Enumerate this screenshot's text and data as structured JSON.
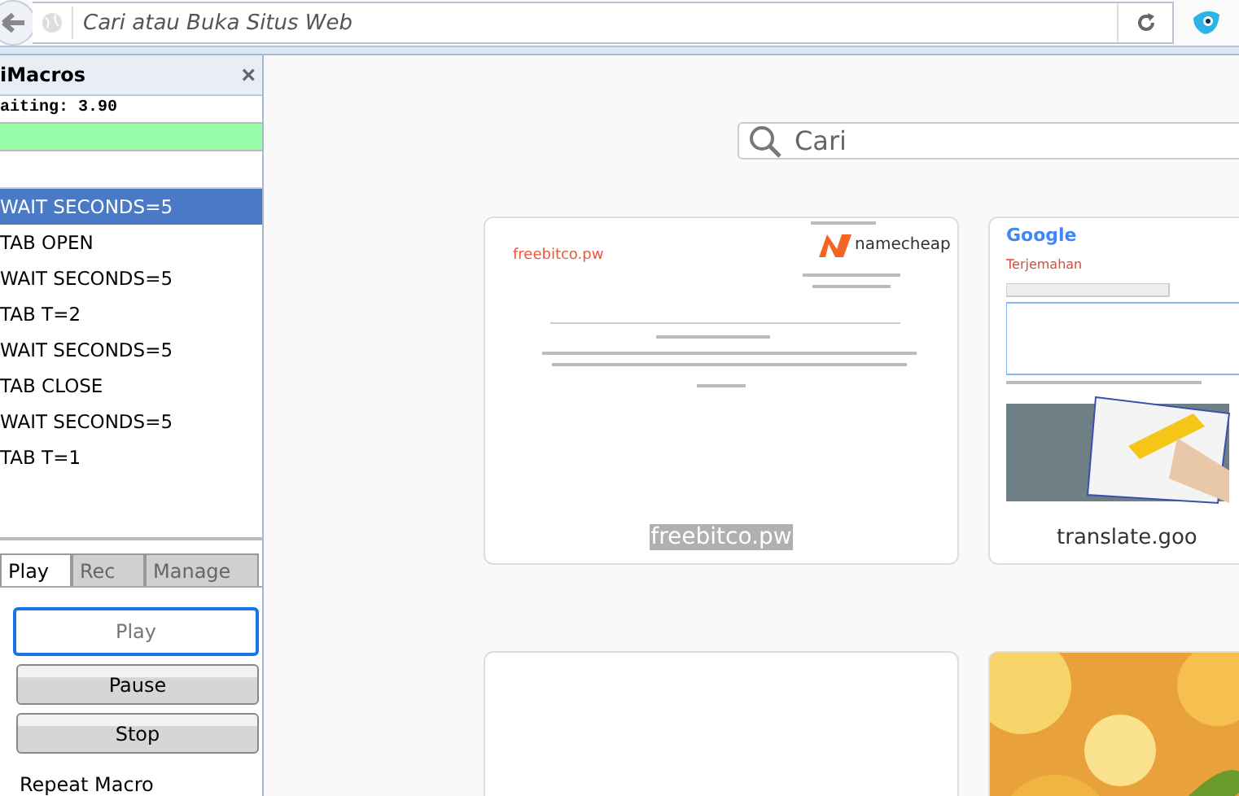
{
  "toolbar": {
    "url_placeholder": "Cari atau Buka Situs Web"
  },
  "sidebar": {
    "title": "iMacros",
    "close": "×",
    "status": "aiting: 3.90",
    "progress": {
      "level": 1
    },
    "macro_lines": [
      {
        "text": "WAIT SECONDS=5",
        "selected": true
      },
      {
        "text": "TAB OPEN",
        "selected": false
      },
      {
        "text": "WAIT SECONDS=5",
        "selected": false
      },
      {
        "text": "TAB T=2",
        "selected": false
      },
      {
        "text": "WAIT SECONDS=5",
        "selected": false
      },
      {
        "text": "TAB CLOSE",
        "selected": false
      },
      {
        "text": "WAIT SECONDS=5",
        "selected": false
      },
      {
        "text": "TAB T=1",
        "selected": false
      }
    ],
    "tabs": [
      {
        "label": "Play",
        "selected": true
      },
      {
        "label": "Rec",
        "selected": false
      },
      {
        "label": "Manage",
        "selected": false
      }
    ],
    "buttons": [
      {
        "label": "Play",
        "disabled": true
      },
      {
        "label": "Pause",
        "disabled": false
      },
      {
        "label": "Stop",
        "disabled": false
      }
    ],
    "repeat_label": "Repeat Macro"
  },
  "new_tab": {
    "search": {
      "placeholder": "Cari"
    },
    "tiles": [
      {
        "kind": "parked",
        "title": "freebitco.pw",
        "site": "freebitco.pw",
        "brand": "namecheap",
        "highlighted": true
      },
      {
        "kind": "translate",
        "brand": "Google",
        "title": "Terjemahan",
        "site": "translate.goo",
        "highlighted": false
      },
      {
        "kind": "blank"
      },
      {
        "kind": "picture"
      }
    ]
  }
}
